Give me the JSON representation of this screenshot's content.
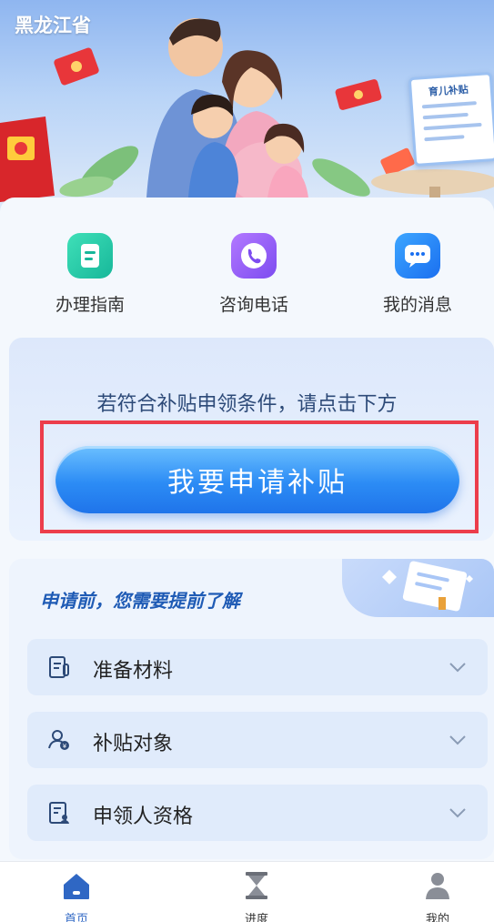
{
  "banner": {
    "region": "黑龙江省",
    "doc_title": "育儿补贴"
  },
  "quick_actions": [
    {
      "label": "办理指南",
      "icon": "guide-icon"
    },
    {
      "label": "咨询电话",
      "icon": "phone-icon"
    },
    {
      "label": "我的消息",
      "icon": "message-icon"
    }
  ],
  "apply": {
    "hint": "若符合补贴申领条件，请点击下方",
    "button_label": "我要申请补贴"
  },
  "info": {
    "title": "申请前，您需要提前了解",
    "items": [
      {
        "label": "准备材料",
        "icon": "materials-icon"
      },
      {
        "label": "补贴对象",
        "icon": "recipient-icon"
      },
      {
        "label": "申领人资格",
        "icon": "qualification-icon"
      }
    ]
  },
  "tabbar": {
    "items": [
      {
        "label": "首页",
        "icon": "home-icon",
        "active": true
      },
      {
        "label": "进度",
        "icon": "hourglass-icon",
        "active": false
      },
      {
        "label": "我的",
        "icon": "user-icon",
        "active": false
      }
    ]
  },
  "colors": {
    "accent": "#2c8cf5",
    "highlight": "#ec3d4b",
    "active_tab": "#2f67c4"
  }
}
